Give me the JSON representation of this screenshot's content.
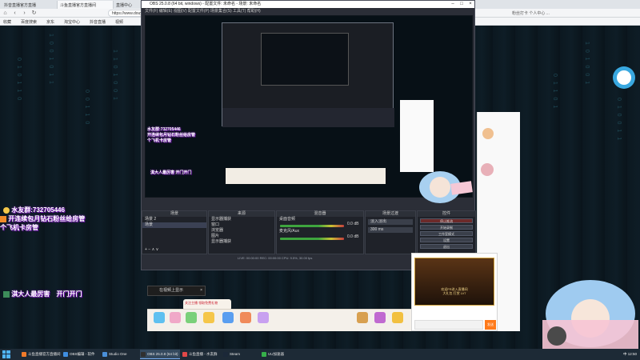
{
  "browser": {
    "tabs": [
      {
        "label": "抖音直播官方直播",
        "active": false
      },
      {
        "label": "斗鱼直播官方直播间",
        "active": true
      },
      {
        "label": "直播中心",
        "active": false
      }
    ],
    "url": "https://www.douyu.com/topic/...",
    "bookmarks": [
      "收藏",
      "百度搜索",
      "京东",
      "淘宝中心",
      "抖音直播",
      "视频"
    ],
    "right_text": "粉丝打卡 个人中心 ..."
  },
  "danmaku": {
    "line1": "水友群:732705446",
    "line2": "开连续包月钻石粉丝给房管",
    "line3": "个飞机卡房管",
    "line4": "淇大人最厉害",
    "line4b": "开门开门"
  },
  "obs": {
    "title": "OBS 25.0.8 (64 bit, windows) - 配置文件: 未命名 - 场景: 未命名",
    "menu": "文件(F)  编辑(E)  视图(V)  配置文件(P)  场景集合(S)  工具(T)  帮助(H)",
    "docks": {
      "scenes_title": "场景",
      "scenes": [
        "场景 2",
        "场景"
      ],
      "sources_title": "来源",
      "sources": [
        "显示器捕获",
        "窗口",
        "浏览器",
        "图片",
        "显示器捕获"
      ],
      "mixer_title": "混音器",
      "mixer_tracks": [
        {
          "name": "桌面音频",
          "db": "0.0 dB"
        },
        {
          "name": "麦克风/Aux",
          "db": "0.0 dB"
        }
      ],
      "transitions_title": "场景过渡",
      "transition": "淡入淡出",
      "duration": "300 ms",
      "controls_title": "控件",
      "controls": [
        "停止推流",
        "开始录制",
        "工作室模式",
        "设置",
        "退出"
      ]
    },
    "status": "LIVE: 00:00:00   REC: 00:00:00   CPU: 9.5%, 30.00 fps"
  },
  "stream": {
    "pip_label": "在视频上显示",
    "follow_tip": "关注主播 领取免费礼物",
    "gift_banner": "欢迎FR进入直播间",
    "gift_sub": "大礼包 打赏 LV7",
    "send_label": "发送"
  },
  "taskbar": {
    "items": [
      {
        "label": "斗鱼直播官方直播间",
        "color": "#f07a2a"
      },
      {
        "label": "OBS编辑 - 软件",
        "color": "#3f8ee0"
      },
      {
        "label": "Studio One",
        "color": "#4a8fd8"
      },
      {
        "label": "OBS 25.0.8 (64 bit)",
        "color": "#303030"
      },
      {
        "label": "斗鱼直播 - 水友群",
        "color": "#e04848"
      },
      {
        "label": "Steam",
        "color": "#1b2838"
      },
      {
        "label": "UU加速器",
        "color": "#36b04a"
      }
    ],
    "tray": "中  12:50"
  },
  "colors": {
    "danmaku_outline": "#8a1fcf",
    "obs_bg": "#2b2e37",
    "accent_orange": "#ff7a1a"
  }
}
